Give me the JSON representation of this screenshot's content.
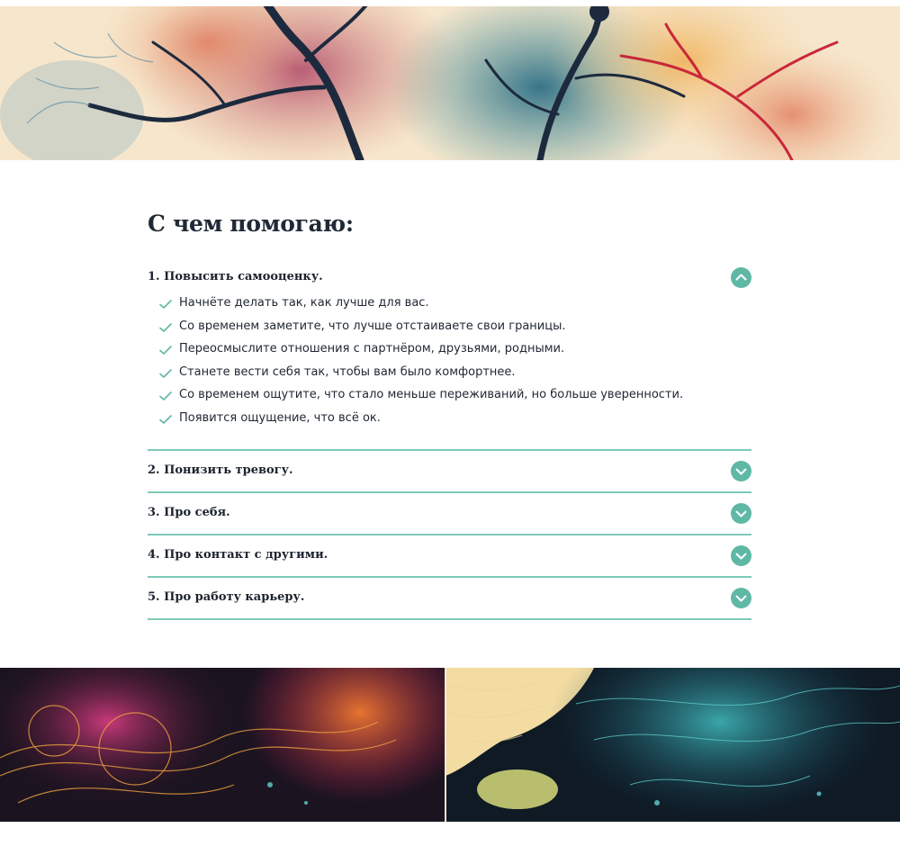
{
  "page": {
    "heading": "С чем помогаю:",
    "colors": {
      "accent": "#5fb8a4",
      "divider": "#7fc9b8",
      "text": "#1f2733"
    }
  },
  "accordion": {
    "items": [
      {
        "title": "1. Повысить самооценку.",
        "expanded": true,
        "toggle_icon": "chevron-up-icon",
        "lines": [
          "Начнёте делать так, как лучше для вас.",
          "Со временем заметите, что лучше отстаиваете свои границы.",
          "Переосмыслите отношения с партнёром, друзьями, родными.",
          "Станете вести себя так, чтобы вам было комфортнее.",
          "Со временем ощутите, что стало меньше переживаний, но больше уверенности.",
          "Появится ощущение, что всё ок."
        ],
        "line_icon": "check-icon"
      },
      {
        "title": "2. Понизить тревогу.",
        "expanded": false,
        "toggle_icon": "chevron-down-icon"
      },
      {
        "title": "3. Про себя.",
        "expanded": false,
        "toggle_icon": "chevron-down-icon"
      },
      {
        "title": "4. Про контакт с другими.",
        "expanded": false,
        "toggle_icon": "chevron-down-icon"
      },
      {
        "title": "5. Про работу карьеру.",
        "expanded": false,
        "toggle_icon": "chevron-down-icon"
      }
    ]
  },
  "images": {
    "top_banner": "watercolor-trees-brain-illustration",
    "bottom_banner": "colorful-neural-brain-illustration"
  }
}
